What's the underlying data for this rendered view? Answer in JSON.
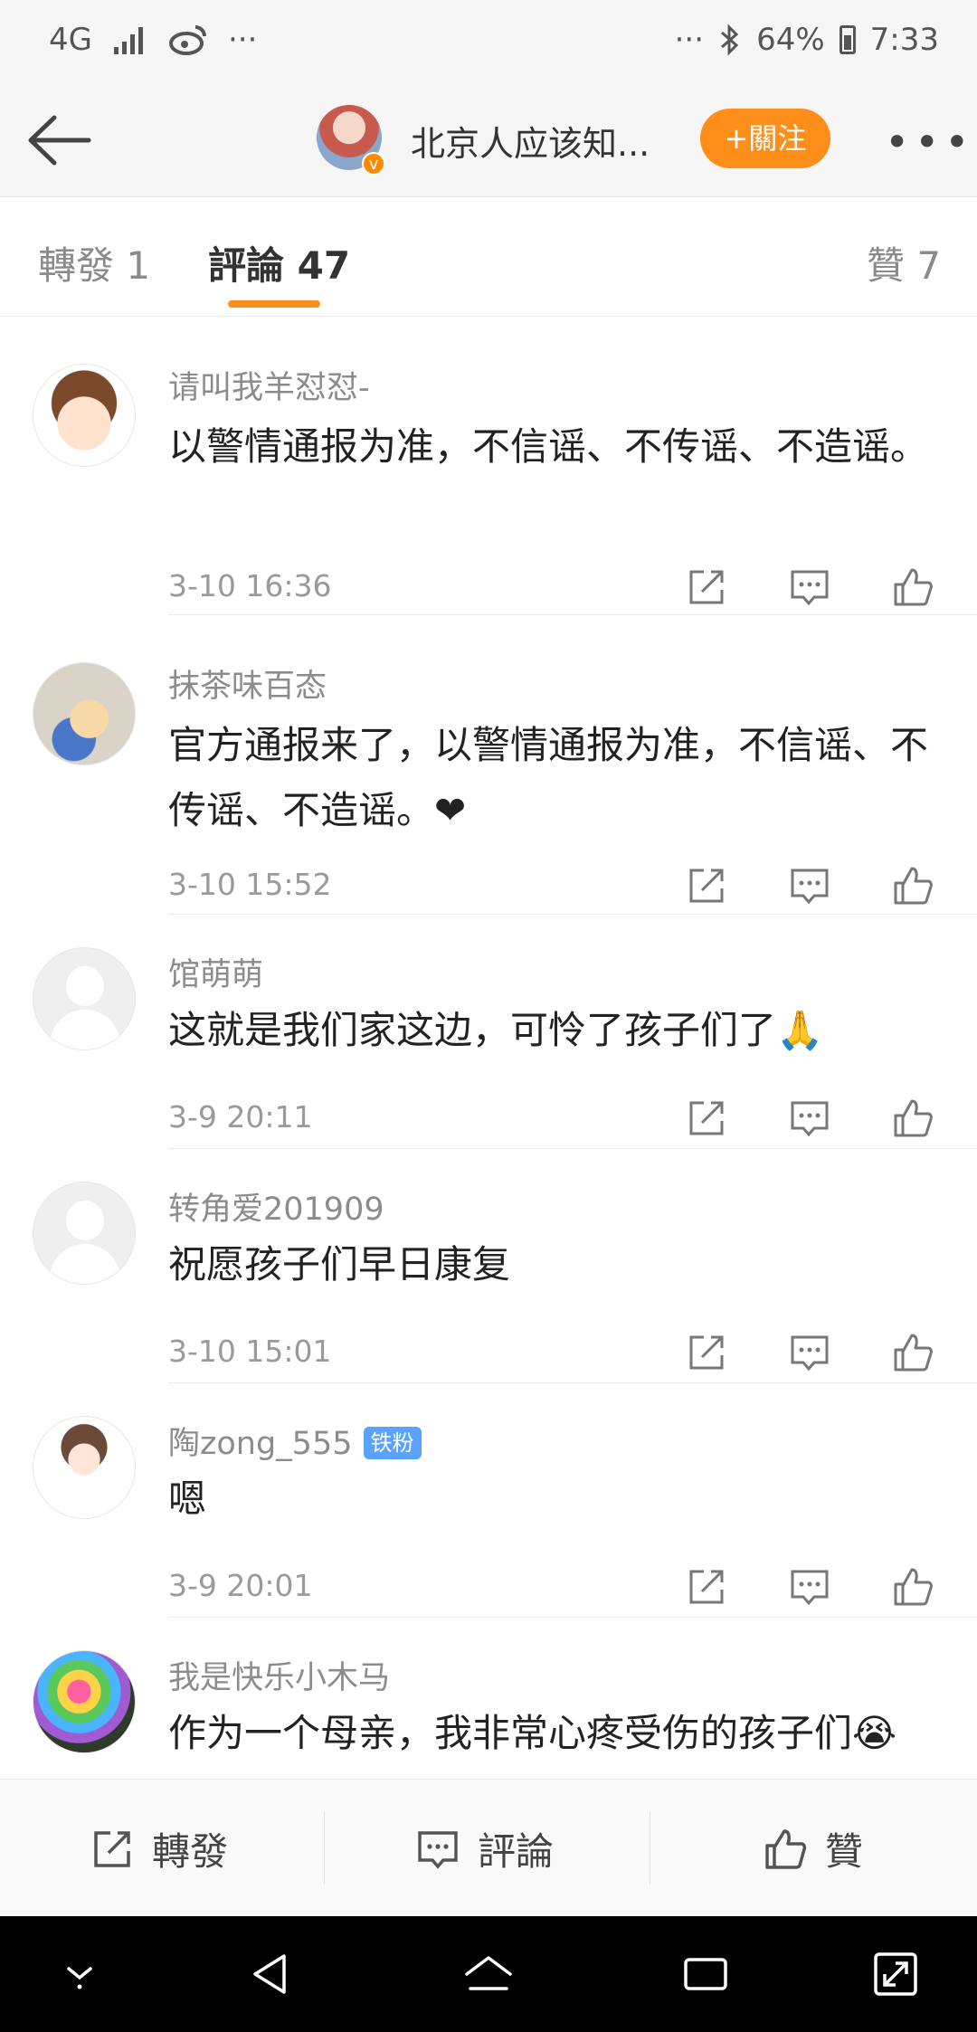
{
  "status": {
    "network": "4G",
    "left_more": "···",
    "right_more": "···",
    "battery": "64%",
    "time": "7:33"
  },
  "header": {
    "title": "北京人应该知...",
    "follow_label": "+關注",
    "verified_mark": "v"
  },
  "tabs": [
    {
      "label": "轉發 1"
    },
    {
      "label": "評論 47"
    },
    {
      "label": "贊 7"
    }
  ],
  "comments": [
    {
      "author": "请叫我羊怼怼-",
      "text": "以警情通报为准，不信谣、不传谣、不造谣。",
      "time": "3-10 16:36",
      "avatar": "boy",
      "badge": ""
    },
    {
      "author": "抹茶味百态",
      "text": "官方通报来了，以警情通报为准，不信谣、不传谣、不造谣。❤",
      "time": "3-10 15:52",
      "avatar": "girl",
      "badge": ""
    },
    {
      "author": "馆萌萌",
      "text": "这就是我们家这边，可怜了孩子们了🙏",
      "time": "3-9 20:11",
      "avatar": "placeholder",
      "badge": ""
    },
    {
      "author": "转角爱201909",
      "text": "祝愿孩子们早日康复",
      "time": "3-10 15:01",
      "avatar": "placeholder",
      "badge": ""
    },
    {
      "author": "陶zong_555",
      "text": "嗯",
      "time": "3-9 20:01",
      "avatar": "cartoon",
      "badge": "铁粉"
    },
    {
      "author": "我是快乐小木马",
      "text": "作为一个母亲，我非常心疼受伤的孩子们😭",
      "time": "",
      "avatar": "rose",
      "badge": ""
    }
  ],
  "actionbar": {
    "repost": "轉發",
    "comment": "評論",
    "like": "贊"
  }
}
